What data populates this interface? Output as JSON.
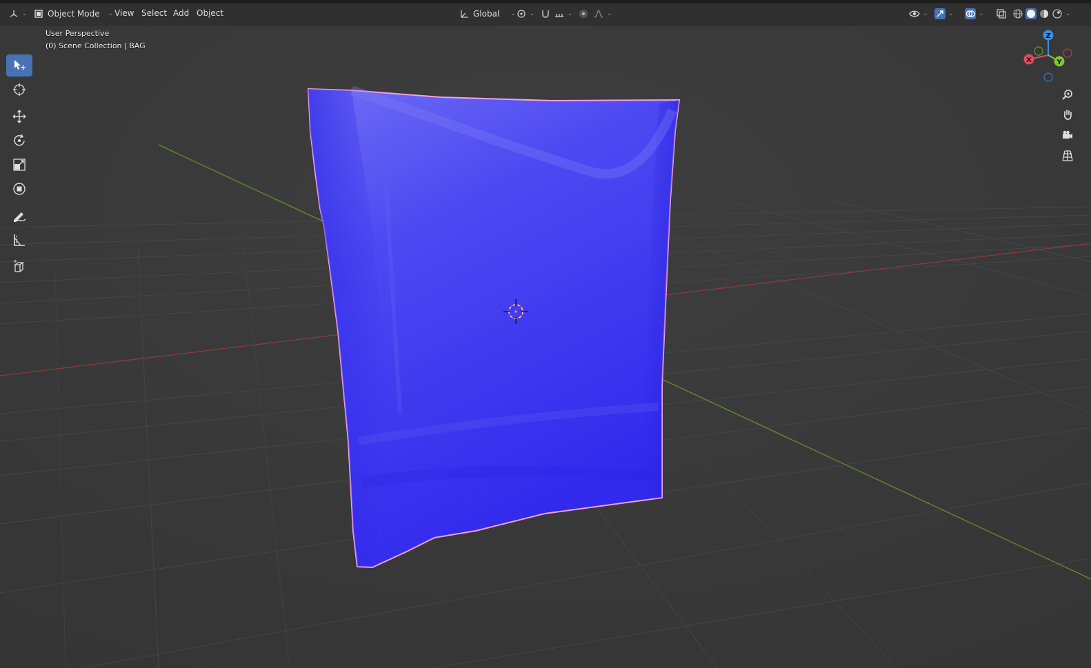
{
  "header": {
    "editor_type_icon": "view3d-icon",
    "mode_label": "Object Mode",
    "menus": [
      "View",
      "Select",
      "Add",
      "Object"
    ],
    "transform_orientation": "Global"
  },
  "viewport": {
    "view_name": "User Perspective",
    "collection_info": "(0) Scene Collection | BAG"
  },
  "gizmo": {
    "axes": {
      "x": "X",
      "y": "Y",
      "z": "Z"
    },
    "colors": {
      "x": "#e04a5f",
      "y": "#7dc633",
      "z": "#3c8ee0"
    }
  },
  "object": {
    "name": "BAG",
    "color": "#3c36f0",
    "outline_color": "#f0a0e0"
  },
  "toolbar": {
    "tools": [
      "select-box-icon",
      "cursor-icon",
      "move-icon",
      "rotate-icon",
      "scale-icon",
      "transform-icon",
      "annotate-icon",
      "measure-icon",
      "add-cube-icon"
    ]
  },
  "nav": [
    "zoom-icon",
    "pan-hand-icon",
    "camera-icon",
    "ortho-grid-icon"
  ]
}
